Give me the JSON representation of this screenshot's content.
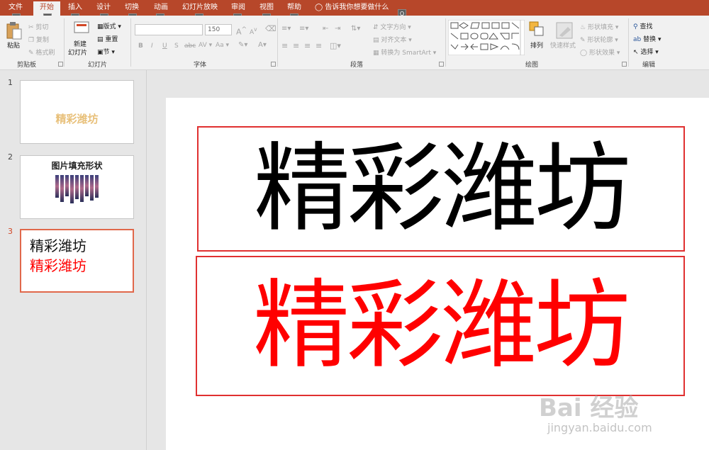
{
  "tabs": [
    {
      "label": "文件",
      "key": "F"
    },
    {
      "label": "开始",
      "key": "H"
    },
    {
      "label": "插入",
      "key": "N"
    },
    {
      "label": "设计",
      "key": "G"
    },
    {
      "label": "切换",
      "key": "K"
    },
    {
      "label": "动画",
      "key": "A"
    },
    {
      "label": "幻灯片放映",
      "key": "S"
    },
    {
      "label": "审阅",
      "key": "R"
    },
    {
      "label": "视图",
      "key": "W"
    },
    {
      "label": "帮助",
      "key": "Y"
    }
  ],
  "tell_me": {
    "label": "告诉我你想要做什么",
    "key": "Q"
  },
  "clipboard": {
    "paste": "粘贴",
    "cut": "剪切",
    "copy": "复制",
    "format_painter": "格式刷",
    "group": "剪贴板"
  },
  "slides_group": {
    "new_slide_line1": "新建",
    "new_slide_line2": "幻灯片",
    "layout": "版式",
    "reset": "重置",
    "section": "节",
    "group": "幻灯片"
  },
  "font": {
    "name_value": "",
    "size_value": "150",
    "bold": "B",
    "italic": "I",
    "underline": "U",
    "strike": "S",
    "shadow": "abc",
    "spacing": "AV",
    "case": "Aa",
    "grow": "A",
    "shrink": "A",
    "group": "字体"
  },
  "paragraph": {
    "text_direction": "文字方向",
    "align_text": "对齐文本",
    "smartart": "转换为 SmartArt",
    "group": "段落"
  },
  "drawing": {
    "arrange": "排列",
    "quick_styles": "快速样式",
    "shape_fill": "形状填充",
    "shape_outline": "形状轮廓",
    "shape_effects": "形状效果",
    "group": "绘图"
  },
  "editing": {
    "find": "查找",
    "replace": "替换",
    "select": "选择",
    "group": "编辑"
  },
  "slides": [
    {
      "number": "1",
      "title": "精彩潍坊"
    },
    {
      "number": "2",
      "title": "图片填充形状"
    },
    {
      "number": "3",
      "line1": "精彩潍坊",
      "line2": "精彩潍坊"
    }
  ],
  "main_slide": {
    "text_black": "精彩潍坊",
    "text_red": "精彩潍坊"
  },
  "colors": {
    "accent": "#b7472a",
    "red_text": "#ff0000",
    "box_border": "#e03030",
    "thumb1_text": "#e8c07a"
  },
  "watermark": {
    "logo": "Bai 经验",
    "url": "jingyan.baidu.com"
  }
}
